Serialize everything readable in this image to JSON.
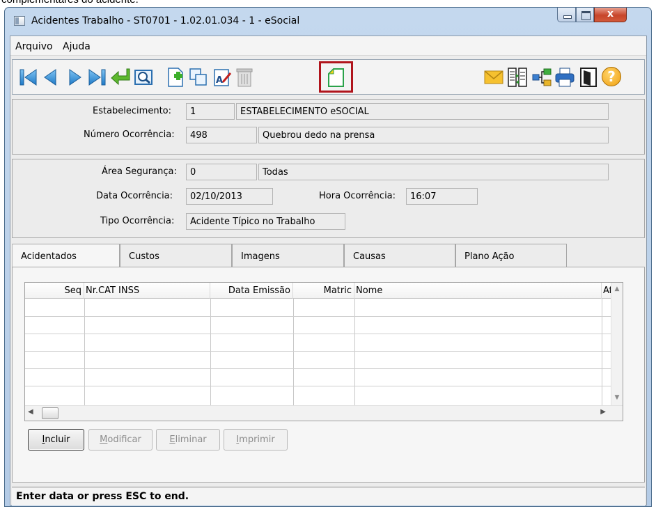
{
  "top_caption": "complementares do acidente.",
  "window": {
    "title": "Acidentes Trabalho - ST0701 - 1.02.01.034 - 1 - eSocial",
    "close_glyph": "x"
  },
  "menu": [
    "Arquivo",
    "Ajuda"
  ],
  "toolbar": {
    "highlight_color": "#b0141c",
    "left_icons": [
      "first-record-icon",
      "previous-record-icon",
      "next-record-icon",
      "last-record-icon",
      "go-to-icon",
      "search-icon",
      "new-record-icon",
      "copy-icon",
      "edit-icon",
      "delete-icon",
      "new-document-icon"
    ],
    "right_icons": [
      "email-icon",
      "columns-icon",
      "tree-icon",
      "print-icon",
      "exit-icon",
      "help-icon"
    ],
    "help_glyph": "?"
  },
  "header": {
    "estabelecimento_label": "Estabelecimento:",
    "estabelecimento_code": "1",
    "estabelecimento_name": "ESTABELECIMENTO eSOCIAL",
    "numero_label": "Número Ocorrência:",
    "numero_value": "498",
    "numero_desc": "Quebrou dedo na prensa"
  },
  "details": {
    "area_label": "Área Segurança:",
    "area_code": "0",
    "area_name": "Todas",
    "data_label": "Data Ocorrência:",
    "data_value": "02/10/2013",
    "hora_label": "Hora Ocorrência:",
    "hora_value": "16:07",
    "tipo_label": "Tipo Ocorrência:",
    "tipo_value": "Acidente Típico no Trabalho"
  },
  "tabs": [
    "Acidentados",
    "Custos",
    "Imagens",
    "Causas",
    "Plano Ação"
  ],
  "active_tab": "Acidentados",
  "grid": {
    "columns": [
      "Seq",
      "Nr.CAT INSS",
      "Data Emissão",
      "Matric",
      "Nome",
      "Afa"
    ],
    "rows": []
  },
  "buttons": {
    "incluir": {
      "first": "I",
      "rest": "ncluir"
    },
    "modificar": {
      "first": "M",
      "rest": "odificar"
    },
    "eliminar": {
      "first": "E",
      "rest": "liminar"
    },
    "imprimir": {
      "first": "I",
      "rest": "mprimir"
    }
  },
  "status": "Enter data or press ESC to end."
}
